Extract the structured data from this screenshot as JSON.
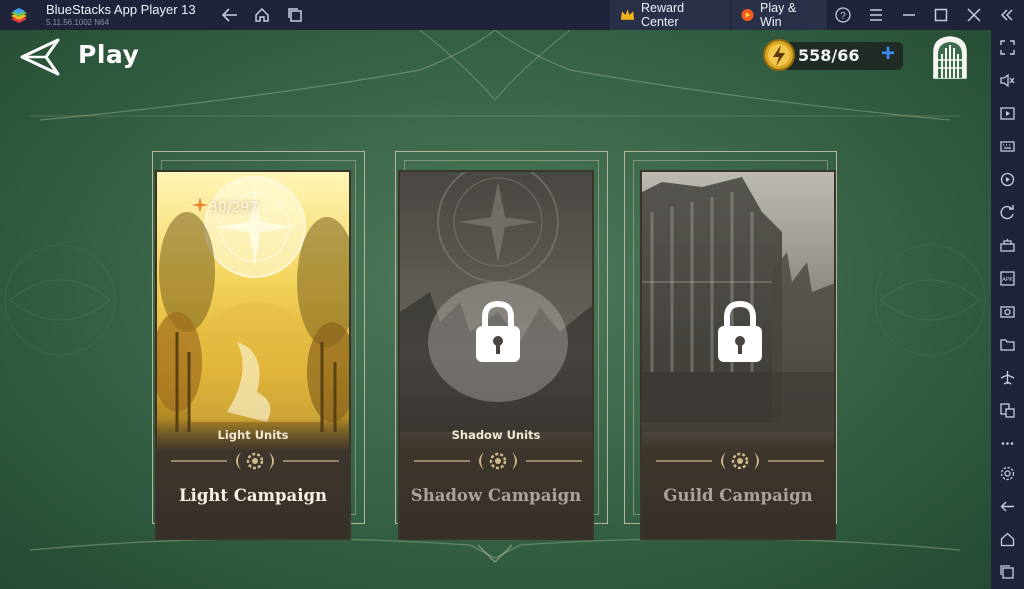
{
  "window": {
    "app_title": "BlueStacks App Player 13",
    "version": "5.11.56.1002  N64",
    "reward_center": "Reward Center",
    "play_win": "Play & Win"
  },
  "icons": {
    "topbar": [
      "bluestacks-logo-icon",
      "back-arrow-icon",
      "home-icon",
      "multi-instance-icon",
      "crown-icon",
      "play-win-icon",
      "help-icon",
      "menu-icon",
      "minimize-icon",
      "maximize-icon",
      "close-icon",
      "collapse-icon"
    ],
    "sidebar": [
      "fullscreen-icon",
      "volume-icon",
      "media-icon",
      "keyboard-icon",
      "rotate-icon",
      "refresh-icon",
      "macro-icon",
      "apk-icon",
      "screenshot-icon",
      "folder-icon",
      "airplane-icon",
      "multi-window-icon",
      "more-icon",
      "settings-icon",
      "back-icon",
      "home-icon",
      "recents-icon"
    ]
  },
  "header": {
    "title": "Play",
    "currency": "558/66",
    "plus": "+"
  },
  "cards": [
    {
      "name": "light",
      "units": "Light Units",
      "title": "Light Campaign",
      "progress": "30/297",
      "locked": false,
      "accent": "#d9b43a"
    },
    {
      "name": "shadow",
      "units": "Shadow Units",
      "title": "Shadow Campaign",
      "locked": true,
      "accent": "#6a6560"
    },
    {
      "name": "guild",
      "units": "",
      "title": "Guild Campaign",
      "locked": true,
      "accent": "#6a6560"
    }
  ],
  "colors": {
    "bg_green": "#3e6a4d",
    "frame_gold": "#b8b79a",
    "bluestacks_bar": "#20243a",
    "plus_blue": "#3c8ff0"
  }
}
